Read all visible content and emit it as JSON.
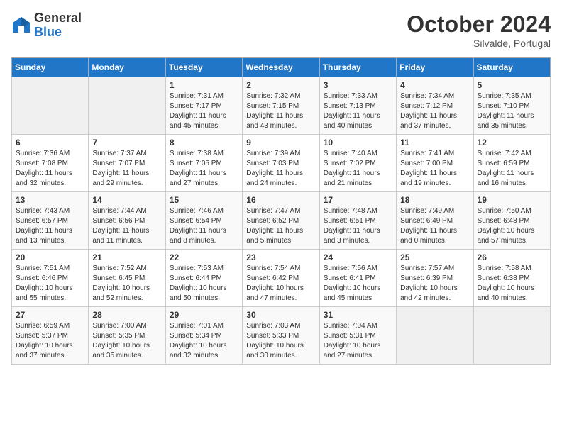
{
  "header": {
    "logo_general": "General",
    "logo_blue": "Blue",
    "month": "October 2024",
    "location": "Silvalde, Portugal"
  },
  "days_of_week": [
    "Sunday",
    "Monday",
    "Tuesday",
    "Wednesday",
    "Thursday",
    "Friday",
    "Saturday"
  ],
  "weeks": [
    [
      {
        "day": "",
        "info": ""
      },
      {
        "day": "",
        "info": ""
      },
      {
        "day": "1",
        "info": "Sunrise: 7:31 AM\nSunset: 7:17 PM\nDaylight: 11 hours and 45 minutes."
      },
      {
        "day": "2",
        "info": "Sunrise: 7:32 AM\nSunset: 7:15 PM\nDaylight: 11 hours and 43 minutes."
      },
      {
        "day": "3",
        "info": "Sunrise: 7:33 AM\nSunset: 7:13 PM\nDaylight: 11 hours and 40 minutes."
      },
      {
        "day": "4",
        "info": "Sunrise: 7:34 AM\nSunset: 7:12 PM\nDaylight: 11 hours and 37 minutes."
      },
      {
        "day": "5",
        "info": "Sunrise: 7:35 AM\nSunset: 7:10 PM\nDaylight: 11 hours and 35 minutes."
      }
    ],
    [
      {
        "day": "6",
        "info": "Sunrise: 7:36 AM\nSunset: 7:08 PM\nDaylight: 11 hours and 32 minutes."
      },
      {
        "day": "7",
        "info": "Sunrise: 7:37 AM\nSunset: 7:07 PM\nDaylight: 11 hours and 29 minutes."
      },
      {
        "day": "8",
        "info": "Sunrise: 7:38 AM\nSunset: 7:05 PM\nDaylight: 11 hours and 27 minutes."
      },
      {
        "day": "9",
        "info": "Sunrise: 7:39 AM\nSunset: 7:03 PM\nDaylight: 11 hours and 24 minutes."
      },
      {
        "day": "10",
        "info": "Sunrise: 7:40 AM\nSunset: 7:02 PM\nDaylight: 11 hours and 21 minutes."
      },
      {
        "day": "11",
        "info": "Sunrise: 7:41 AM\nSunset: 7:00 PM\nDaylight: 11 hours and 19 minutes."
      },
      {
        "day": "12",
        "info": "Sunrise: 7:42 AM\nSunset: 6:59 PM\nDaylight: 11 hours and 16 minutes."
      }
    ],
    [
      {
        "day": "13",
        "info": "Sunrise: 7:43 AM\nSunset: 6:57 PM\nDaylight: 11 hours and 13 minutes."
      },
      {
        "day": "14",
        "info": "Sunrise: 7:44 AM\nSunset: 6:56 PM\nDaylight: 11 hours and 11 minutes."
      },
      {
        "day": "15",
        "info": "Sunrise: 7:46 AM\nSunset: 6:54 PM\nDaylight: 11 hours and 8 minutes."
      },
      {
        "day": "16",
        "info": "Sunrise: 7:47 AM\nSunset: 6:52 PM\nDaylight: 11 hours and 5 minutes."
      },
      {
        "day": "17",
        "info": "Sunrise: 7:48 AM\nSunset: 6:51 PM\nDaylight: 11 hours and 3 minutes."
      },
      {
        "day": "18",
        "info": "Sunrise: 7:49 AM\nSunset: 6:49 PM\nDaylight: 11 hours and 0 minutes."
      },
      {
        "day": "19",
        "info": "Sunrise: 7:50 AM\nSunset: 6:48 PM\nDaylight: 10 hours and 57 minutes."
      }
    ],
    [
      {
        "day": "20",
        "info": "Sunrise: 7:51 AM\nSunset: 6:46 PM\nDaylight: 10 hours and 55 minutes."
      },
      {
        "day": "21",
        "info": "Sunrise: 7:52 AM\nSunset: 6:45 PM\nDaylight: 10 hours and 52 minutes."
      },
      {
        "day": "22",
        "info": "Sunrise: 7:53 AM\nSunset: 6:44 PM\nDaylight: 10 hours and 50 minutes."
      },
      {
        "day": "23",
        "info": "Sunrise: 7:54 AM\nSunset: 6:42 PM\nDaylight: 10 hours and 47 minutes."
      },
      {
        "day": "24",
        "info": "Sunrise: 7:56 AM\nSunset: 6:41 PM\nDaylight: 10 hours and 45 minutes."
      },
      {
        "day": "25",
        "info": "Sunrise: 7:57 AM\nSunset: 6:39 PM\nDaylight: 10 hours and 42 minutes."
      },
      {
        "day": "26",
        "info": "Sunrise: 7:58 AM\nSunset: 6:38 PM\nDaylight: 10 hours and 40 minutes."
      }
    ],
    [
      {
        "day": "27",
        "info": "Sunrise: 6:59 AM\nSunset: 5:37 PM\nDaylight: 10 hours and 37 minutes."
      },
      {
        "day": "28",
        "info": "Sunrise: 7:00 AM\nSunset: 5:35 PM\nDaylight: 10 hours and 35 minutes."
      },
      {
        "day": "29",
        "info": "Sunrise: 7:01 AM\nSunset: 5:34 PM\nDaylight: 10 hours and 32 minutes."
      },
      {
        "day": "30",
        "info": "Sunrise: 7:03 AM\nSunset: 5:33 PM\nDaylight: 10 hours and 30 minutes."
      },
      {
        "day": "31",
        "info": "Sunrise: 7:04 AM\nSunset: 5:31 PM\nDaylight: 10 hours and 27 minutes."
      },
      {
        "day": "",
        "info": ""
      },
      {
        "day": "",
        "info": ""
      }
    ]
  ]
}
